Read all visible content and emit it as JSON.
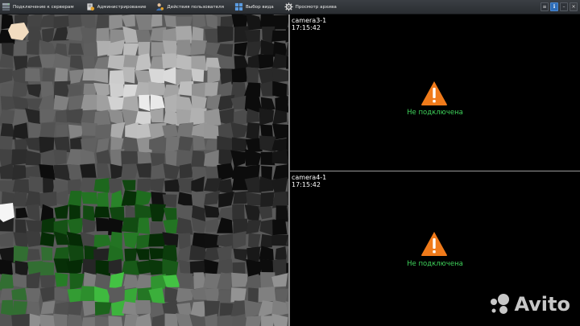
{
  "toolbar": {
    "items": [
      {
        "label": "Подключение к серверам",
        "icon": "servers-icon"
      },
      {
        "label": "Администрирование",
        "icon": "admin-icon"
      },
      {
        "label": "Действия пользователя",
        "icon": "user-actions-icon"
      },
      {
        "label": "Выбор вида",
        "icon": "view-select-icon"
      },
      {
        "label": "Просмотр архива",
        "icon": "archive-gear-icon"
      }
    ],
    "window_buttons": {
      "menu": "≡",
      "info": "i",
      "minimize": "–",
      "close": "×"
    }
  },
  "cameras": [
    {
      "name": "camera3-1",
      "time": "17:15:42",
      "status": "Не подключена",
      "status_color": "#3fd35b"
    },
    {
      "name": "camera4-1",
      "time": "17:15:42",
      "status": "Не подключена",
      "status_color": "#3fd35b"
    }
  ],
  "warning_color": "#f07a1a",
  "watermark": {
    "text": "Avito"
  }
}
